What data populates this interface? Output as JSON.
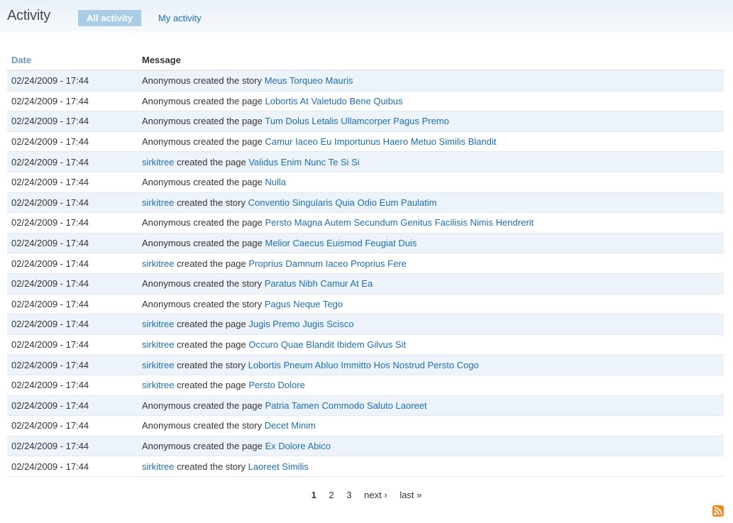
{
  "header": {
    "title": "Activity",
    "tabs": [
      {
        "label": "All activity",
        "active": true
      },
      {
        "label": "My activity",
        "active": false
      }
    ]
  },
  "table": {
    "columns": [
      "Date",
      "Message"
    ],
    "rows": [
      {
        "date": "02/24/2009 - 17:44",
        "user": "Anonymous",
        "user_link": false,
        "action": "created the story",
        "title": "Meus Torqueo Mauris"
      },
      {
        "date": "02/24/2009 - 17:44",
        "user": "Anonymous",
        "user_link": false,
        "action": "created the page",
        "title": "Lobortis At Valetudo Bene Quibus"
      },
      {
        "date": "02/24/2009 - 17:44",
        "user": "Anonymous",
        "user_link": false,
        "action": "created the page",
        "title": "Tum Dolus Letalis Ullamcorper Pagus Premo"
      },
      {
        "date": "02/24/2009 - 17:44",
        "user": "Anonymous",
        "user_link": false,
        "action": "created the page",
        "title": "Camur Iaceo Eu Importunus Haero Metuo Similis Blandit"
      },
      {
        "date": "02/24/2009 - 17:44",
        "user": "sirkitree",
        "user_link": true,
        "action": "created the page",
        "title": "Validus Enim Nunc Te Si Si"
      },
      {
        "date": "02/24/2009 - 17:44",
        "user": "Anonymous",
        "user_link": false,
        "action": "created the page",
        "title": "Nulla"
      },
      {
        "date": "02/24/2009 - 17:44",
        "user": "sirkitree",
        "user_link": true,
        "action": "created the story",
        "title": "Conventio Singularis Quia Odio Eum Paulatim"
      },
      {
        "date": "02/24/2009 - 17:44",
        "user": "Anonymous",
        "user_link": false,
        "action": "created the page",
        "title": "Persto Magna Autem Secundum Genitus Facilisis Nimis Hendrerit"
      },
      {
        "date": "02/24/2009 - 17:44",
        "user": "Anonymous",
        "user_link": false,
        "action": "created the page",
        "title": "Melior Caecus Euismod Feugiat Duis"
      },
      {
        "date": "02/24/2009 - 17:44",
        "user": "sirkitree",
        "user_link": true,
        "action": "created the page",
        "title": "Proprius Damnum Iaceo Proprius Fere"
      },
      {
        "date": "02/24/2009 - 17:44",
        "user": "Anonymous",
        "user_link": false,
        "action": "created the story",
        "title": "Paratus Nibh Camur At Ea"
      },
      {
        "date": "02/24/2009 - 17:44",
        "user": "Anonymous",
        "user_link": false,
        "action": "created the story",
        "title": "Pagus Neque Tego"
      },
      {
        "date": "02/24/2009 - 17:44",
        "user": "sirkitree",
        "user_link": true,
        "action": "created the page",
        "title": "Jugis Premo Jugis Scisco"
      },
      {
        "date": "02/24/2009 - 17:44",
        "user": "sirkitree",
        "user_link": true,
        "action": "created the page",
        "title": "Occuro Quae Blandit Ibidem Gilvus Sit"
      },
      {
        "date": "02/24/2009 - 17:44",
        "user": "sirkitree",
        "user_link": true,
        "action": "created the story",
        "title": "Lobortis Pneum Abluo Immitto Hos Nostrud Persto Cogo"
      },
      {
        "date": "02/24/2009 - 17:44",
        "user": "sirkitree",
        "user_link": true,
        "action": "created the page",
        "title": "Persto Dolore"
      },
      {
        "date": "02/24/2009 - 17:44",
        "user": "Anonymous",
        "user_link": false,
        "action": "created the page",
        "title": "Patria Tamen Commodo Saluto Laoreet"
      },
      {
        "date": "02/24/2009 - 17:44",
        "user": "Anonymous",
        "user_link": false,
        "action": "created the story",
        "title": "Decet Minim"
      },
      {
        "date": "02/24/2009 - 17:44",
        "user": "Anonymous",
        "user_link": false,
        "action": "created the page",
        "title": "Ex Dolore Abico"
      },
      {
        "date": "02/24/2009 - 17:44",
        "user": "sirkitree",
        "user_link": true,
        "action": "created the story",
        "title": "Laoreet Similis"
      }
    ]
  },
  "pager": {
    "current": "1",
    "pages": [
      "2",
      "3"
    ],
    "next": "next ›",
    "last": "last »"
  },
  "feed": {
    "icon": "rss-feed-icon",
    "color": "#f08a24"
  },
  "colors": {
    "link": "#1c6fb1",
    "odd_row": "#edf3fa",
    "active_tab": "#a9cde7",
    "date_header": "#6e99c2"
  }
}
